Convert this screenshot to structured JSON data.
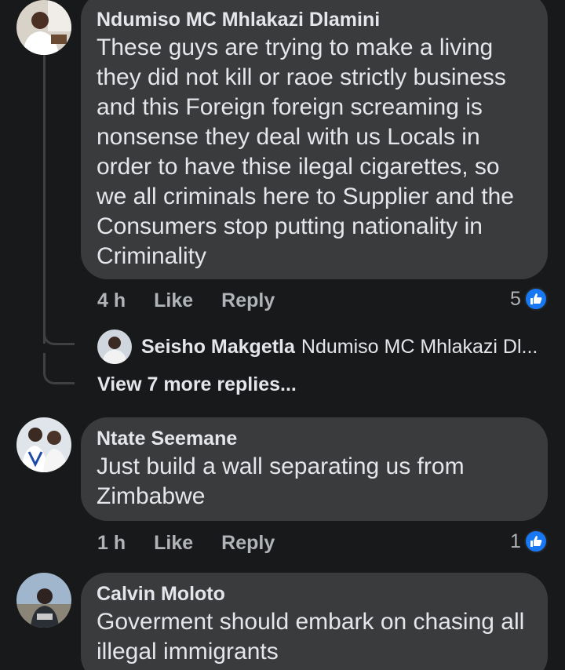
{
  "comments": [
    {
      "author": "Ndumiso MC Mhlakazi Dlamini",
      "text": "These guys are trying to make a living they did not kill or raoe  strictly business and this Foreign foreign screaming is nonsense they deal with us Locals in order to have thise ilegal cigarettes, so we all criminals here to Supplier and the Consumers stop putting nationality in Criminality",
      "time": "4 h",
      "like_label": "Like",
      "reply_label": "Reply",
      "reaction_count": "5",
      "reply_preview": {
        "author": "Seisho Makgetla",
        "text": "Ndumiso MC Mhlakazi Dl..."
      },
      "view_more": "View 7 more replies..."
    },
    {
      "author": "Ntate Seemane",
      "text": "Just build a wall separating us from Zimbabwe",
      "time": "1 h",
      "like_label": "Like",
      "reply_label": "Reply",
      "reaction_count": "1"
    },
    {
      "author": "Calvin Moloto",
      "text": "Goverment should embark on chasing all illegal immigrants"
    }
  ],
  "colors": {
    "background": "#18191a",
    "bubble": "#3a3b3c",
    "like_blue": "#1877f2",
    "secondary_text": "#b0b3b8"
  },
  "icons": {
    "reaction": "like-thumb-icon"
  }
}
